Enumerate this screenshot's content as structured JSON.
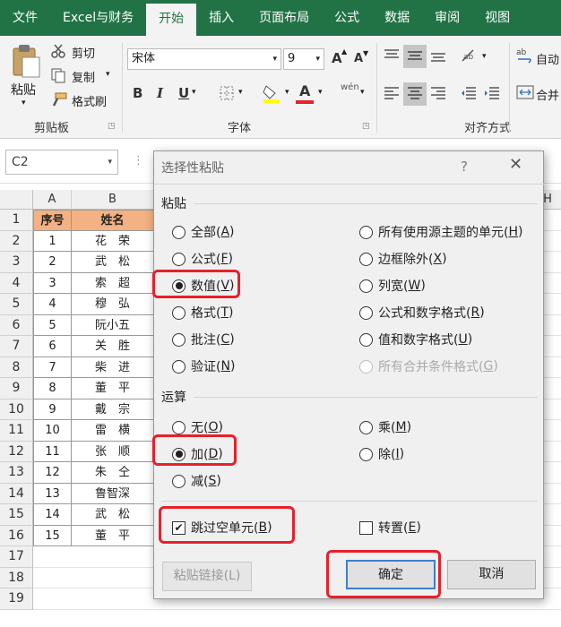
{
  "ribbon_tabs": [
    "文件",
    "Excel与财务",
    "开始",
    "插入",
    "页面布局",
    "公式",
    "数据",
    "审阅",
    "视图"
  ],
  "active_tab": "开始",
  "clipboard": {
    "paste": "粘贴",
    "cut": "剪切",
    "copy": "复制",
    "format_painter": "格式刷",
    "group": "剪贴板"
  },
  "font": {
    "name": "宋体",
    "size": "9",
    "grow": "A",
    "shrink": "A",
    "bold": "B",
    "italic": "I",
    "underline": "U",
    "color_letter": "A",
    "wen": "wén",
    "group": "字体"
  },
  "align": {
    "wrap": "自动",
    "merge": "合并",
    "group": "对齐方式"
  },
  "namebox": "C2",
  "sheet": {
    "col_a": "A",
    "col_b": "B",
    "col_h": "H",
    "header": [
      "序号",
      "姓名"
    ],
    "rows": [
      [
        "1",
        "花　荣"
      ],
      [
        "2",
        "武　松"
      ],
      [
        "3",
        "索　超"
      ],
      [
        "4",
        "穆　弘"
      ],
      [
        "5",
        "阮小五"
      ],
      [
        "6",
        "关　胜"
      ],
      [
        "7",
        "柴　进"
      ],
      [
        "8",
        "董　平"
      ],
      [
        "9",
        "戴　宗"
      ],
      [
        "10",
        "雷　横"
      ],
      [
        "11",
        "张　顺"
      ],
      [
        "12",
        "朱　仝"
      ],
      [
        "13",
        "鲁智深"
      ],
      [
        "14",
        "武　松"
      ],
      [
        "15",
        "董　平"
      ]
    ],
    "row_numbers": [
      "1",
      "2",
      "3",
      "4",
      "5",
      "6",
      "7",
      "8",
      "9",
      "10",
      "11",
      "12",
      "13",
      "14",
      "15",
      "16",
      "17",
      "18",
      "19"
    ]
  },
  "dialog": {
    "title": "选择性粘贴",
    "help": "?",
    "close": "✕",
    "paste_section": "粘贴",
    "paste_left": [
      {
        "text": "全部(",
        "key": "A",
        "end": ")",
        "checked": false
      },
      {
        "text": "公式(",
        "key": "F",
        "end": ")",
        "checked": false
      },
      {
        "text": "数值(",
        "key": "V",
        "end": ")",
        "checked": true
      },
      {
        "text": "格式(",
        "key": "T",
        "end": ")",
        "checked": false
      },
      {
        "text": "批注(",
        "key": "C",
        "end": ")",
        "checked": false
      },
      {
        "text": "验证(",
        "key": "N",
        "end": ")",
        "checked": false
      }
    ],
    "paste_right": [
      {
        "text": "所有使用源主题的单元(",
        "key": "H",
        "end": ")",
        "disabled": false
      },
      {
        "text": "边框除外(",
        "key": "X",
        "end": ")",
        "disabled": false
      },
      {
        "text": "列宽(",
        "key": "W",
        "end": ")",
        "disabled": false
      },
      {
        "text": "公式和数字格式(",
        "key": "R",
        "end": ")",
        "disabled": false
      },
      {
        "text": "值和数字格式(",
        "key": "U",
        "end": ")",
        "disabled": false
      },
      {
        "text": "所有合并条件格式(",
        "key": "G",
        "end": ")",
        "disabled": true
      }
    ],
    "op_section": "运算",
    "op_left": [
      {
        "text": "无(",
        "key": "O",
        "end": ")",
        "checked": false
      },
      {
        "text": "加(",
        "key": "D",
        "end": ")",
        "checked": true
      },
      {
        "text": "减(",
        "key": "S",
        "end": ")",
        "checked": false
      }
    ],
    "op_right": [
      {
        "text": "乘(",
        "key": "M",
        "end": ")"
      },
      {
        "text": "除(",
        "key": "I",
        "end": ")"
      }
    ],
    "skip_blanks": {
      "text": "跳过空单元(",
      "key": "B",
      "end": ")",
      "checked": true
    },
    "transpose": {
      "text": "转置(",
      "key": "E",
      "end": ")",
      "checked": false
    },
    "paste_link": "粘贴链接(L)",
    "ok": "确定",
    "cancel": "取消"
  },
  "colors": {
    "excel_green": "#217346",
    "header_fill": "#f4b183",
    "highlight": "#e8202a"
  }
}
